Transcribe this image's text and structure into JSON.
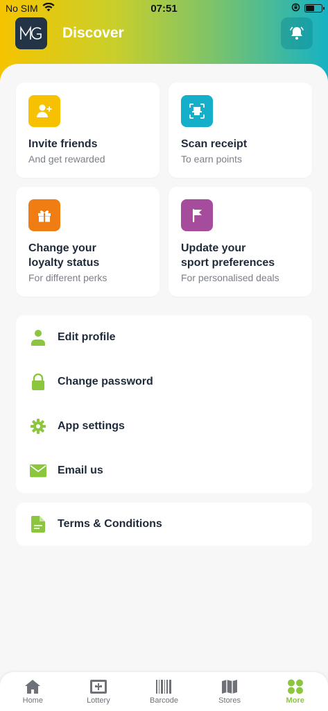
{
  "status_bar": {
    "carrier": "No SIM",
    "time": "07:51",
    "battery_level": 0.55
  },
  "header": {
    "logo_text": "MG",
    "title": "Discover"
  },
  "cards": [
    {
      "title_lines": [
        "Invite friends"
      ],
      "subtitle": "And get rewarded",
      "icon": "add-user-icon",
      "color": "#f5c100"
    },
    {
      "title_lines": [
        "Scan receipt"
      ],
      "subtitle": "To earn points",
      "icon": "scan-receipt-icon",
      "color": "#16afc9"
    },
    {
      "title_lines": [
        "Change your",
        "loyalty status"
      ],
      "subtitle": "For different perks",
      "icon": "gift-icon",
      "color": "#f07c14"
    },
    {
      "title_lines": [
        "Update your",
        "sport preferences"
      ],
      "subtitle": "For personalised deals",
      "icon": "flag-icon",
      "color": "#a64c9c"
    }
  ],
  "menu": [
    {
      "label": "Edit profile",
      "icon": "user-icon"
    },
    {
      "label": "Change password",
      "icon": "lock-icon"
    },
    {
      "label": "App settings",
      "icon": "gear-icon"
    },
    {
      "label": "Email us",
      "icon": "envelope-icon"
    }
  ],
  "menu2": [
    {
      "label": "Terms & Conditions",
      "icon": "document-icon"
    }
  ],
  "tabs": [
    {
      "label": "Home",
      "icon": "home-icon",
      "active": false
    },
    {
      "label": "Lottery",
      "icon": "lottery-ticket-icon",
      "active": false
    },
    {
      "label": "Barcode",
      "icon": "barcode-icon",
      "active": false
    },
    {
      "label": "Stores",
      "icon": "map-icon",
      "active": false
    },
    {
      "label": "More",
      "icon": "grid-icon",
      "active": true
    }
  ],
  "colors": {
    "accent_green": "#8cc63f",
    "tab_inactive": "#6e7178",
    "text_dark": "#1f2a3a"
  }
}
